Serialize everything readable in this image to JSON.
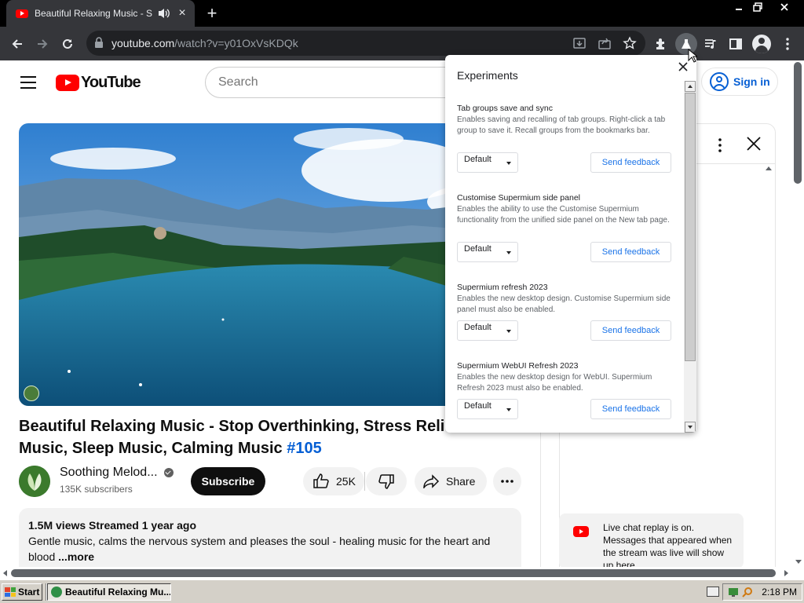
{
  "browser": {
    "tab_title": "Beautiful Relaxing Music - Stop Overthinking",
    "tab_close": "×",
    "new_tab": "+",
    "url_host": "youtube.com",
    "url_path": "/watch?v=y01OxVsKDQk"
  },
  "yt": {
    "logo_text": "YouTube",
    "search_placeholder": "Search",
    "sign_in": "Sign in",
    "video_title": "Beautiful Relaxing Music - Stop Overthinking, Stress Relief Music, Sleep Music, Calming Music",
    "video_tag": "#105",
    "channel_name": "Soothing Melod...",
    "subscribers": "135K subscribers",
    "subscribe": "Subscribe",
    "likes": "25K",
    "share": "Share",
    "views_line": "1.5M views  Streamed 1 year ago",
    "description": "Gentle music, calms the nervous system and pleases the soul - healing music for the heart and blood",
    "more": "...more",
    "chat_replay": "Live chat replay is on. Messages that appeared when the stream was live will show up here."
  },
  "experiments": {
    "title": "Experiments",
    "items": [
      {
        "name": "Tab groups save and sync",
        "description": "Enables saving and recalling of tab groups. Right-click a tab group to save it. Recall groups from the bookmarks bar.",
        "select": "Default",
        "feedback": "Send feedback"
      },
      {
        "name": "Customise Supermium side panel",
        "description": "Enables the ability to use the Customise Supermium functionality from the unified side panel on the New tab page.",
        "select": "Default",
        "feedback": "Send feedback"
      },
      {
        "name": "Supermium refresh 2023",
        "description": "Enables the new desktop design. Customise Supermium side panel must also be enabled.",
        "select": "Default",
        "feedback": "Send feedback"
      },
      {
        "name": "Supermium WebUI Refresh 2023",
        "description": "Enables the new desktop design for WebUI. Supermium Refresh 2023 must also be enabled.",
        "select": "Default",
        "feedback": "Send feedback"
      }
    ]
  },
  "taskbar": {
    "start": "Start",
    "task": "Beautiful Relaxing Mu...",
    "clock": "2:18 PM"
  },
  "colors": {
    "yt_red": "#ff0000",
    "link_blue": "#065fd4",
    "chrome_dark": "#35363a",
    "taskbar": "#d4d0c8"
  }
}
